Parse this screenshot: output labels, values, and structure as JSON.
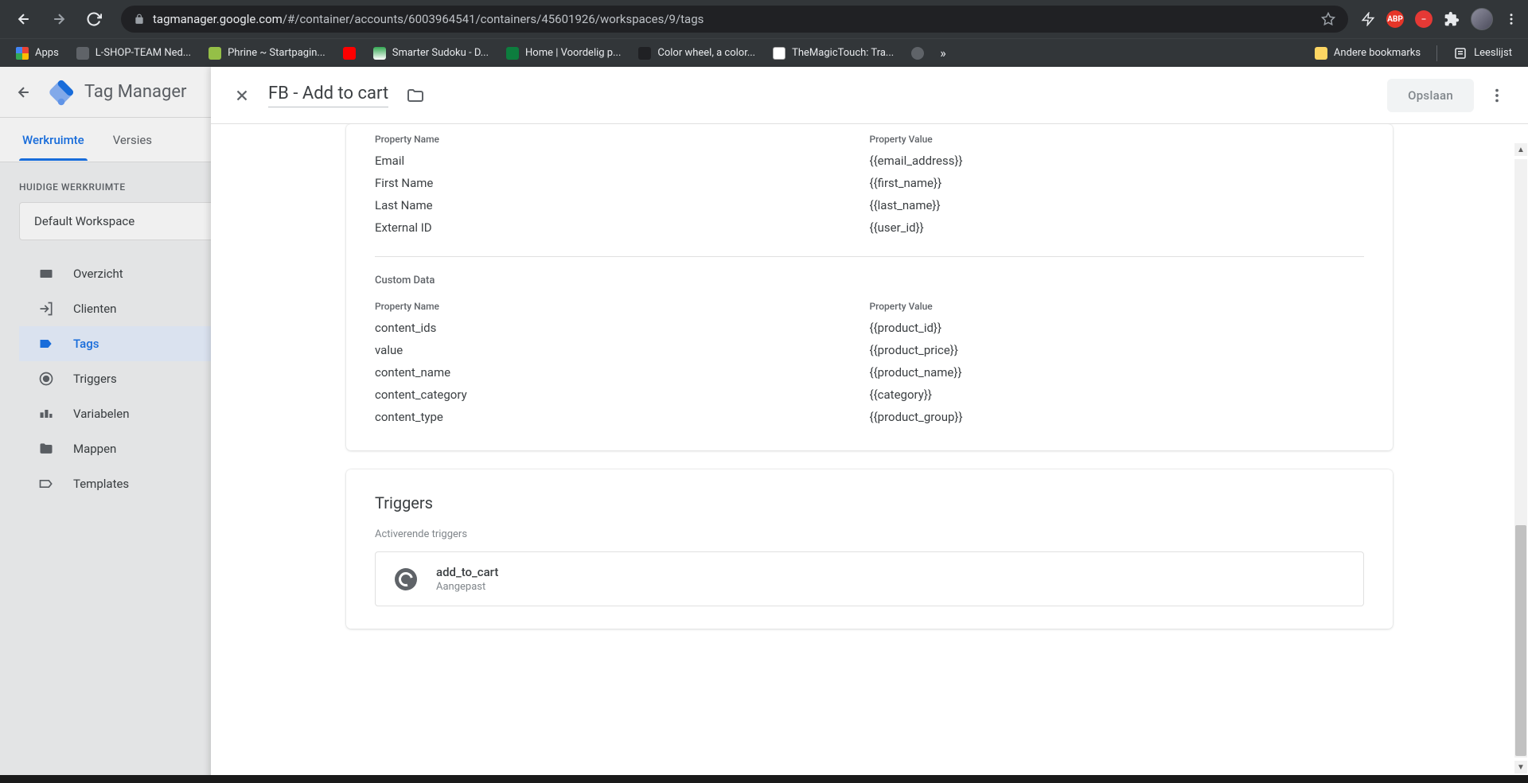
{
  "browser": {
    "url_host": "tagmanager.google.com",
    "url_path": "/#/container/accounts/6003964541/containers/45601926/workspaces/9/tags",
    "bookmarks": [
      {
        "label": "Apps",
        "color": "#fff"
      },
      {
        "label": "L-SHOP-TEAM Ned...",
        "color": "#5f6368"
      },
      {
        "label": "Phrine ~ Startpagin...",
        "color": "#95bf47"
      },
      {
        "label": "",
        "color": "#ff0000"
      },
      {
        "label": "Smarter Sudoku - D...",
        "color": "#34a853"
      },
      {
        "label": "Home | Voordelig p...",
        "color": "#0d7d3e"
      },
      {
        "label": "Color wheel, a color...",
        "color": "#202124"
      },
      {
        "label": "TheMagicTouch: Tra...",
        "color": "#e8e8e8"
      },
      {
        "label": "",
        "color": "#5f6368"
      }
    ],
    "andere": "Andere bookmarks",
    "leeslijst": "Leeslijst"
  },
  "gtm": {
    "product": "Tag Manager",
    "tabs": {
      "workspace": "Werkruimte",
      "versions": "Versies"
    },
    "ws_label": "HUIDIGE WERKRUIMTE",
    "ws_current": "Default Workspace",
    "nav": {
      "overview": "Overzicht",
      "clients": "Clienten",
      "tags": "Tags",
      "triggers": "Triggers",
      "variables": "Variabelen",
      "folders": "Mappen",
      "templates": "Templates"
    }
  },
  "drawer": {
    "title": "FB - Add to cart",
    "save": "Opslaan",
    "th_name": "Property Name",
    "th_value": "Property Value",
    "user_props": [
      {
        "name": "Email",
        "value": "{{email_address}}"
      },
      {
        "name": "First Name",
        "value": "{{first_name}}"
      },
      {
        "name": "Last Name",
        "value": "{{last_name}}"
      },
      {
        "name": "External ID",
        "value": "{{user_id}}"
      }
    ],
    "cd_label": "Custom Data",
    "custom_data": [
      {
        "name": "content_ids",
        "value": "{{product_id}}"
      },
      {
        "name": "value",
        "value": "{{product_price}}"
      },
      {
        "name": "content_name",
        "value": "{{product_name}}"
      },
      {
        "name": "content_category",
        "value": "{{category}}"
      },
      {
        "name": "content_type",
        "value": "{{product_group}}"
      }
    ],
    "triggers_title": "Triggers",
    "activating": "Activerende triggers",
    "trigger_name": "add_to_cart",
    "trigger_type": "Aangepast"
  }
}
